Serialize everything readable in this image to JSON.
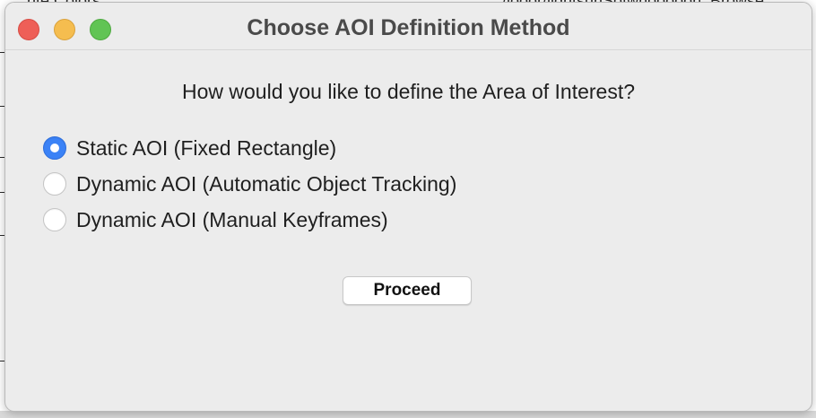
{
  "background": {
    "top_text_left": "nte Colors",
    "top_text_mid": "/looor/lightsurlSotwhooooon",
    "top_text_right": "Browse..."
  },
  "window": {
    "title": "Choose AOI Definition Method",
    "controls": [
      "close",
      "minimize",
      "zoom"
    ]
  },
  "dialog": {
    "question": "How would you like to define the Area of Interest?",
    "options": [
      {
        "label": "Static AOI (Fixed Rectangle)",
        "selected": true
      },
      {
        "label": "Dynamic AOI (Automatic Object Tracking)",
        "selected": false
      },
      {
        "label": "Dynamic AOI (Manual Keyframes)",
        "selected": false
      }
    ],
    "proceed_label": "Proceed"
  },
  "colors": {
    "accent": "#3b82f6",
    "close": "#ee5f57",
    "minimize": "#f5bd4f",
    "zoom": "#61c454",
    "window_bg": "#ececec"
  }
}
